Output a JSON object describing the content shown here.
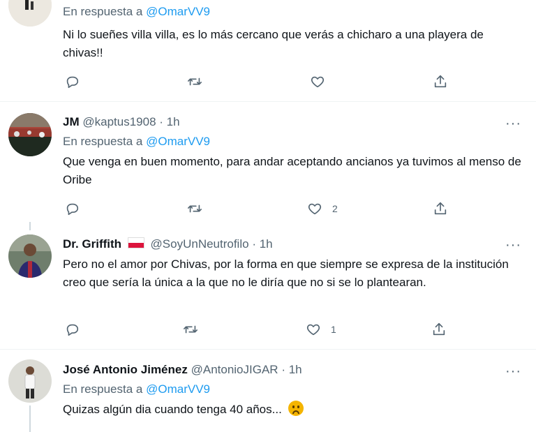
{
  "tweets": [
    {
      "reply_prefix": "En respuesta a",
      "reply_to": "@OmarVV9",
      "text": "Ni lo sueñes villa villa, es lo más cercano que verás a chicharo a una playera de chivas!!",
      "actions": {
        "reply": "",
        "retweet": "",
        "like": "",
        "share": ""
      }
    },
    {
      "name": "JM",
      "handle": "@kaptus1908",
      "dot": "·",
      "time": "1h",
      "more": "···",
      "reply_prefix": "En respuesta a",
      "reply_to": "@OmarVV9",
      "text": "Que venga en buen momento, para andar aceptando ancianos ya tuvimos al menso de Oribe",
      "actions": {
        "reply": "",
        "retweet": "",
        "like": "2",
        "share": ""
      }
    },
    {
      "name": "Dr. Griffith",
      "handle": "@SoyUnNeutrofilo",
      "dot": "·",
      "time": "1h",
      "more": "···",
      "text": "Pero no el amor por Chivas, por la forma en que siempre se expresa de la institución creo que sería la única a la que no le diría que no si se lo plantearan.",
      "actions": {
        "reply": "",
        "retweet": "",
        "like": "1",
        "share": ""
      }
    },
    {
      "name": "José Antonio Jiménez",
      "handle": "@AntonioJIGAR",
      "dot": "·",
      "time": "1h",
      "more": "···",
      "reply_prefix": "En respuesta a",
      "reply_to": "@OmarVV9",
      "text": "Quizas algún dia cuando tenga 40 años...",
      "emoji": "sad-face"
    }
  ],
  "icons": {
    "reply": "reply-icon",
    "retweet": "retweet-icon",
    "like": "heart-icon",
    "share": "share-icon",
    "more": "more-icon"
  },
  "colors": {
    "link": "#1d9bf0",
    "secondary": "#536471",
    "text": "#0f1419",
    "divider": "#eff3f4"
  }
}
